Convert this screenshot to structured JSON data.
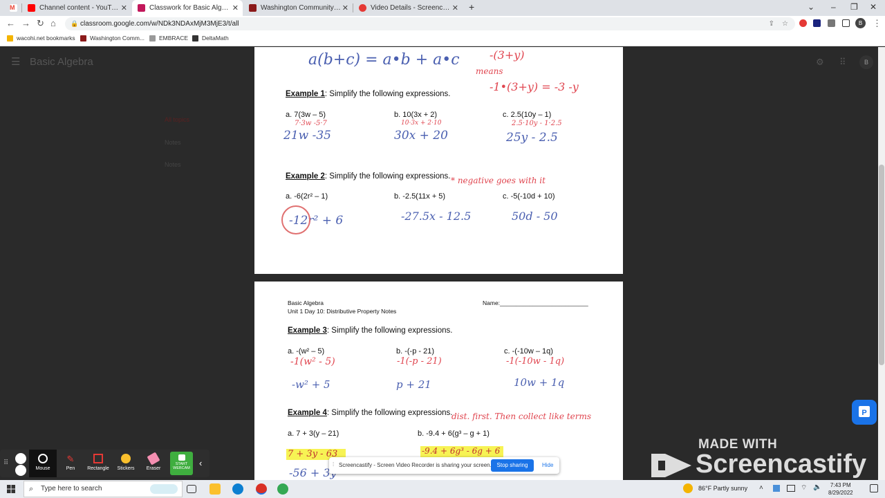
{
  "tabs": [
    {
      "title": "",
      "color": "#ea4335"
    },
    {
      "title": "Channel content - YouTube Studio",
      "color": "#ff0000"
    },
    {
      "title": "Classwork for Basic Algebra",
      "color": "#c2185b"
    },
    {
      "title": "Washington Community High Sc",
      "color": "#8b1a1a"
    },
    {
      "title": "Video Details - Screencastify",
      "color": "#e53935"
    }
  ],
  "new_tab_label": "+",
  "url": "classroom.google.com/w/NDk3NDAxMjM3MjE3/t/all",
  "bookmarks": [
    "wacohi.net bookmarks",
    "Washington Comm...",
    "EMBRACE",
    "DeltaMath"
  ],
  "profile_initial": "B",
  "classroom": {
    "title": "Basic Algebra",
    "dim_items": [
      "All topics",
      "Notes",
      "Notes"
    ]
  },
  "page1": {
    "formula": "a(b+c) = a•b + a•c",
    "red_top": [
      "-(3+y)",
      "means",
      "-1•(3+y) = -3 -y"
    ],
    "ex1": {
      "label": "Example 1",
      "title": ":  Simplify the following expressions.",
      "a": "a.  7(3w – 5)",
      "a_work": "7·3w  -5·7",
      "a_ans": "21w -35",
      "b": "b.  10(3x + 2)",
      "b_work": "10·3x + 2·10",
      "b_ans": "30x + 20",
      "c": "c.  2.5(10y – 1)",
      "c_work": "2.5·10y - 1·2.5",
      "c_ans": "25y - 2.5"
    },
    "ex2": {
      "label": "Example 2",
      "title": ":  Simplify the following expressions.",
      "note": "* negative goes with it",
      "a": "a.  -6(2r² – 1)",
      "a_ans": "-12r² + 6",
      "b": "b.  -2.5(11x + 5)",
      "b_ans": "-27.5x - 12.5",
      "c": "c.  -5(-10d + 10)",
      "c_ans": "50d - 50"
    }
  },
  "page2": {
    "header_course": "Basic Algebra",
    "header_unit": "Unit 1 Day 10: Distributive Property Notes",
    "name_label": "Name:___________________________",
    "ex3": {
      "label": "Example 3",
      "title": ":  Simplify the following expressions.",
      "a": "a.  -(w² – 5)",
      "a_work": "-1(w² - 5)",
      "a_ans": "-w² + 5",
      "b": "b.  -(-p - 21)",
      "b_work": "-1(-p - 21)",
      "b_ans": "p + 21",
      "c": "c.  -(-10w – 1q)",
      "c_work": "-1(-10w - 1q)",
      "c_ans": "10w + 1q"
    },
    "ex4": {
      "label": "Example 4",
      "title": ":  Simplify the following expressions.",
      "note": "dist. first. Then  collect like terms",
      "a": "a.  7 + 3(y – 21)",
      "a_work": "7 + 3y - 63",
      "a_ans": "-56 + 3y",
      "b": "b.  -9.4 + 6(g³ – g + 1)",
      "b_work": "-9.4 + 6g³ - 6g + 6"
    }
  },
  "screencastify": {
    "tools": [
      "Mouse",
      "Pen",
      "Rectangle",
      "Stickers",
      "Eraser",
      "START WEBCAM"
    ],
    "share_text": "Screencastify - Screen Video Recorder is sharing your screen.",
    "stop_label": "Stop sharing",
    "hide_label": "Hide",
    "watermark_top": "MADE WITH",
    "watermark_brand": "Screencastify"
  },
  "taskbar": {
    "search_placeholder": "Type here to search",
    "weather": "86°F  Partly sunny",
    "time": "7:43 PM",
    "date": "8/29/2022"
  }
}
